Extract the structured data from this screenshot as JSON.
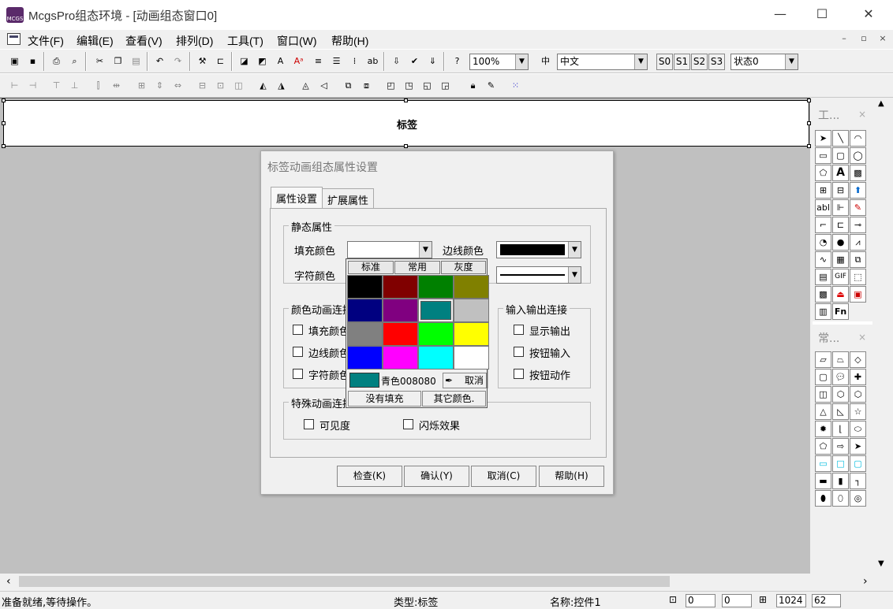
{
  "window": {
    "title": "McgsPro组态环境 - [动画组态窗口0]",
    "icon_text": "MCGS",
    "minimize": "—",
    "maximize": "☐",
    "close": "✕"
  },
  "menu": [
    "文件(F)",
    "编辑(E)",
    "查看(V)",
    "排列(D)",
    "工具(T)",
    "窗口(W)",
    "帮助(H)"
  ],
  "mdi": {
    "min": "–",
    "restore": "▫",
    "close": "×"
  },
  "toolbar1": {
    "zoom": "100%",
    "language": "中文",
    "states": [
      "S0",
      "S1",
      "S2",
      "S3"
    ],
    "state_select": "状态0"
  },
  "canvas": {
    "label_text": "标签"
  },
  "dialog": {
    "title": "标签动画组态属性设置",
    "tabs": [
      "属性设置",
      "扩展属性"
    ],
    "static_group": "静态属性",
    "fill_color_label": "填充颜色",
    "border_color_label": "边线颜色",
    "char_color_label": "字符颜色",
    "color_anim_group": "颜色动画连接",
    "color_anim_items": [
      "填充颜色",
      "边线颜色",
      "字符颜色"
    ],
    "io_group": "输入输出连接",
    "io_items": [
      "显示输出",
      "按钮输入",
      "按钮动作"
    ],
    "special_group": "特殊动画连接",
    "special_items": [
      "可见度",
      "闪烁效果"
    ],
    "buttons": [
      "检查(K)",
      "确认(Y)",
      "取消(C)",
      "帮助(H)"
    ]
  },
  "palette": {
    "tabs": [
      "标准",
      "常用",
      "灰度"
    ],
    "swatches": [
      "#000000",
      "#800000",
      "#008000",
      "#808000",
      "#000080",
      "#800080",
      "#008080",
      "#c0c0c0",
      "#808080",
      "#ff0000",
      "#00ff00",
      "#ffff00",
      "#0000ff",
      "#ff00ff",
      "#00ffff",
      "#ffffff"
    ],
    "selected_name": "青色008080",
    "selected_color": "#008080",
    "cancel": "取消",
    "no_fill": "没有填充",
    "other_colors": "其它颜色."
  },
  "toolbox": {
    "title1": "工...",
    "title2": "常..."
  },
  "status": {
    "message": "准备就绪,等待操作。",
    "type": "类型:标签",
    "name": "名称:控件1",
    "x": "0",
    "y": "0",
    "w": "1024",
    "h": "62"
  }
}
